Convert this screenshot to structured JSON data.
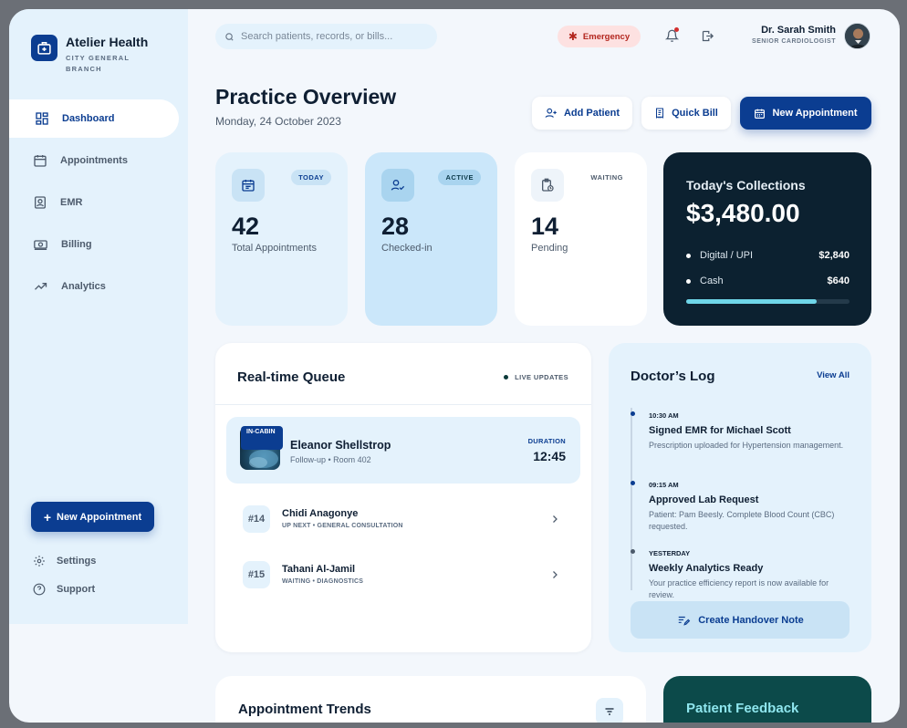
{
  "brand": {
    "name": "Atelier Health",
    "subtitle": "CITY GENERAL BRANCH"
  },
  "sidebar": {
    "items": [
      {
        "label": "Dashboard",
        "icon": "dashboard-icon",
        "active": true
      },
      {
        "label": "Appointments",
        "icon": "calendar-icon",
        "active": false
      },
      {
        "label": "EMR",
        "icon": "id-card-icon",
        "active": false
      },
      {
        "label": "Billing",
        "icon": "cash-icon",
        "active": false
      },
      {
        "label": "Analytics",
        "icon": "trend-icon",
        "active": false
      }
    ],
    "cta_label": "New Appointment",
    "settings_label": "Settings",
    "support_label": "Support"
  },
  "header": {
    "search_placeholder": "Search patients, records, or bills...",
    "emergency_label": "Emergency",
    "user_name": "Dr. Sarah Smith",
    "user_role": "SENIOR CARDIOLOGIST"
  },
  "page": {
    "title": "Practice Overview",
    "date": "Monday, 24 October 2023",
    "add_patient_label": "Add Patient",
    "quick_bill_label": "Quick Bill",
    "new_appointment_label": "New Appointment"
  },
  "stats": [
    {
      "badge": "TODAY",
      "value": "42",
      "label": "Total Appointments"
    },
    {
      "badge": "ACTIVE",
      "value": "28",
      "label": "Checked-in"
    },
    {
      "badge": "WAITING",
      "value": "14",
      "label": "Pending"
    }
  ],
  "collections": {
    "title": "Today's Collections",
    "amount": "$3,480.00",
    "rows": [
      {
        "label": "Digital / UPI",
        "value": "$2,840"
      },
      {
        "label": "Cash",
        "value": "$640"
      }
    ],
    "progress": 0.8
  },
  "queue": {
    "title": "Real-time Queue",
    "live_label": "LIVE UPDATES",
    "current": {
      "tag": "IN-CABIN",
      "name": "Eleanor Shellstrop",
      "sub": "Follow-up • Room 402",
      "duration_label": "DURATION",
      "duration": "12:45"
    },
    "items": [
      {
        "no": "#14",
        "name": "Chidi Anagonye",
        "status": "UP NEXT • GENERAL CONSULTATION"
      },
      {
        "no": "#15",
        "name": "Tahani Al-Jamil",
        "status": "WAITING • DIAGNOSTICS"
      }
    ]
  },
  "log": {
    "title": "Doctor’s Log",
    "view_all": "View All",
    "entries": [
      {
        "time": "10:30 AM",
        "title": "Signed EMR for Michael Scott",
        "desc": "Prescription uploaded for Hypertension management."
      },
      {
        "time": "09:15 AM",
        "title": "Approved Lab Request",
        "desc": "Patient: Pam Beesly. Complete Blood Count (CBC) requested."
      },
      {
        "time": "YESTERDAY",
        "title": "Weekly Analytics Ready",
        "desc": "Your practice efficiency report is now available for review."
      }
    ],
    "handover_label": "Create Handover Note"
  },
  "trends": {
    "title": "Appointment Trends"
  },
  "feedback": {
    "title": "Patient Feedback"
  },
  "colors": {
    "primary": "#0b3d91",
    "dark_card": "#0c2130",
    "light_blue": "#e4f2fc",
    "emergency": "#b3261e",
    "teal": "#0c4a4a"
  }
}
